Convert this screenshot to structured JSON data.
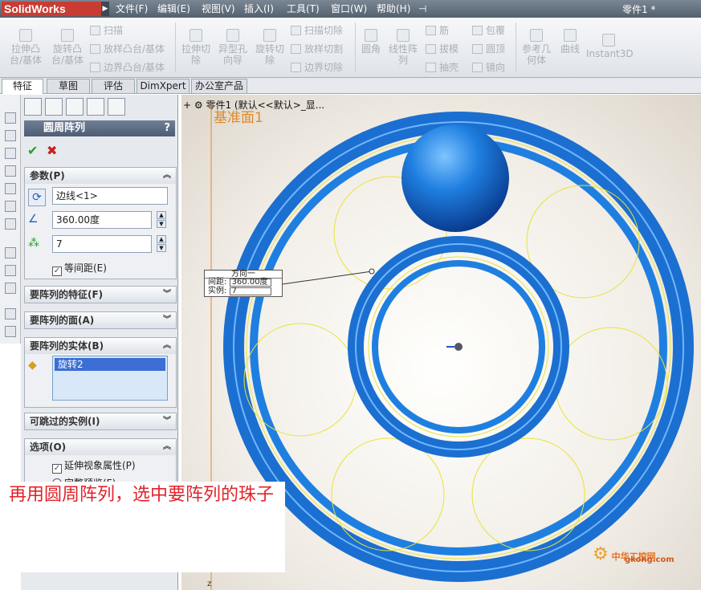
{
  "titlebar": {
    "logo": "SolidWorks",
    "menu": [
      "文件(F)",
      "编辑(E)",
      "视图(V)",
      "插入(I)",
      "工具(T)",
      "窗口(W)",
      "帮助(H)"
    ],
    "doc_title": "零件1 *"
  },
  "ribbon": {
    "extrude_boss": "拉伸凸\n台/基体",
    "revolve_boss": "旋转凸\n台/基体",
    "sweep": "扫描",
    "loft": "放样凸台/基体",
    "boundary": "边界凸台/基体",
    "extrude_cut": "拉伸切\n除",
    "hole_wizard": "异型孔\n向导",
    "revolve_cut": "旋转切\n除",
    "sweep_cut": "扫描切除",
    "loft_cut": "放样切割",
    "boundary_cut": "边界切除",
    "fillet": "圆角",
    "linear_pattern": "线性阵\n列",
    "rib": "筋",
    "draft": "拔模",
    "shell": "抽壳",
    "wrap": "包覆",
    "dome": "圆顶",
    "mirror": "镜向",
    "ref_geometry": "参考几\n何体",
    "curves": "曲线",
    "instant3d": "Instant3D"
  },
  "tabs": [
    "特征",
    "草图",
    "评估",
    "DimXpert",
    "办公室产品"
  ],
  "property_manager": {
    "title": "圆周阵列",
    "help": "?",
    "params_group": "参数(P)",
    "direction_value": "边线<1>",
    "angle_value": "360.00度",
    "instances_value": "7",
    "equal_spacing_label": "等间距(E)",
    "features_group": "要阵列的特征(F)",
    "faces_group": "要阵列的面(A)",
    "bodies_group": "要阵列的实体(B)",
    "body_item": "旋转2",
    "skip_group": "可跳过的实例(I)",
    "options_group": "选项(O)",
    "propagate_label": "延伸视象属性(P)",
    "full_preview_label": "完整预览(F)"
  },
  "viewport": {
    "tree_text": "零件1 (默认<<默认>_显...",
    "plane_label": "基准面1",
    "callout_title": "方向一",
    "callout_spacing_label": "间距:",
    "callout_spacing_value": "360.00度",
    "callout_instances_label": "实例:",
    "callout_instances_value": "7",
    "axis_label": "z"
  },
  "caption": "再用圆周阵列，选中要阵列的珠子",
  "watermark": {
    "name": "中华工控网",
    "url": "gkong.com"
  },
  "colors": {
    "titlebar": "#5f6b78",
    "logo": "#c83c34",
    "pm_header": "#5a6a82",
    "model_blue": "#1f7fe0",
    "sketch_yellow": "#e8e23a",
    "caption_red": "#e2222a"
  }
}
